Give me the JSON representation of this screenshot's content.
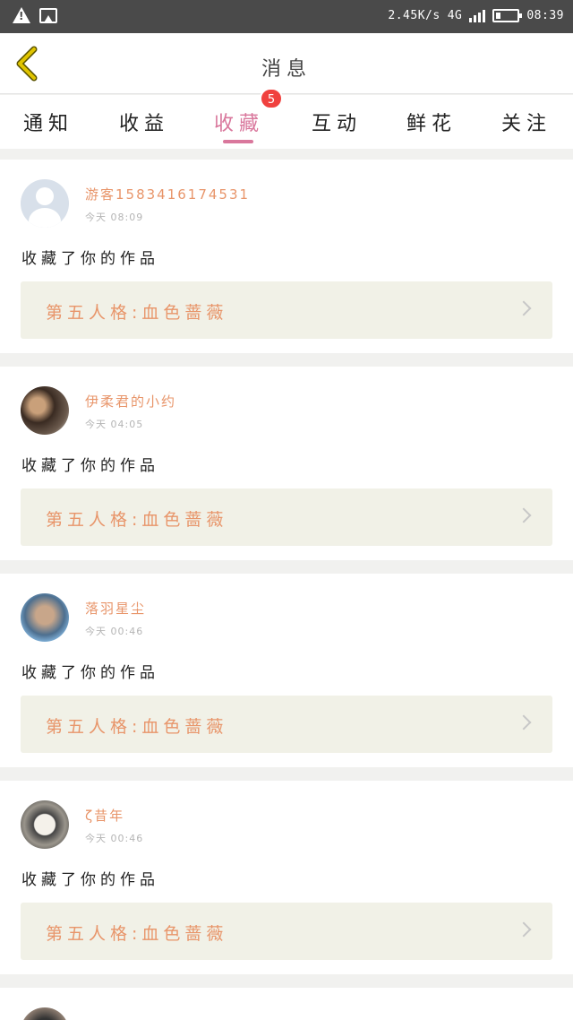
{
  "statusbar": {
    "network_speed": "2.45K/s",
    "network_type": "4G",
    "time": "08:39",
    "icons": [
      "warning-icon",
      "image-notification-icon",
      "signal-icon",
      "battery-icon"
    ]
  },
  "header": {
    "title": "消息",
    "back_icon": "chevron-left-icon",
    "accent_color": "#e0c400"
  },
  "tabs": [
    {
      "label": "通知",
      "active": false
    },
    {
      "label": "收益",
      "active": false
    },
    {
      "label": "收藏",
      "active": true,
      "badge": "5"
    },
    {
      "label": "互动",
      "active": false
    },
    {
      "label": "鲜花",
      "active": false
    },
    {
      "label": "关注",
      "active": false
    }
  ],
  "colors": {
    "active_tab": "#d9779c",
    "badge": "#f0413e",
    "username": "#e8956a",
    "work_bg": "#f1f1e7"
  },
  "messages": [
    {
      "user": "游客15834161745​31",
      "time": "今天 08:09",
      "action": "收藏了你的作品",
      "work": "第五人格:血色蔷薇"
    },
    {
      "user": "伊柔君的小约",
      "time": "今天 04:05",
      "action": "收藏了你的作品",
      "work": "第五人格:血色蔷薇"
    },
    {
      "user": "落羽星尘",
      "time": "今天 00:46",
      "action": "收藏了你的作品",
      "work": "第五人格:血色蔷薇"
    },
    {
      "user": "ζ昔年",
      "time": "今天 00:46",
      "action": "收藏了你的作品",
      "work": "第五人格:血色蔷薇"
    }
  ]
}
